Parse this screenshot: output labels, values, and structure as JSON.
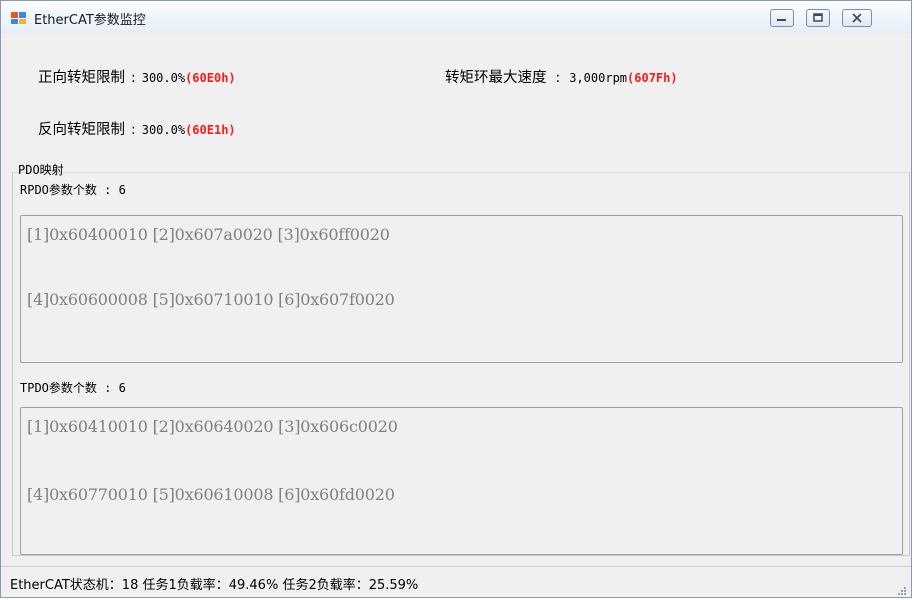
{
  "window": {
    "title": "EtherCAT参数监控"
  },
  "params": {
    "fwd_torque": {
      "label": "正向转矩限制",
      "sep": ":",
      "value": "300.0%",
      "code": "(60E0h)"
    },
    "rev_torque": {
      "label": "反向转矩限制",
      "sep": ":",
      "value": "300.0%",
      "code": "(60E1h)"
    },
    "max_speed": {
      "label": "转矩环最大速度",
      "sep": ":",
      "value": "3,000rpm",
      "code": "(607Fh)"
    }
  },
  "pdo": {
    "title": "PDO映射",
    "rpdo": {
      "count_label": "RPDO参数个数 : 6",
      "lines": [
        "[1]0x60400010 [2]0x607a0020 [3]0x60ff0020",
        "[4]0x60600008 [5]0x60710010 [6]0x607f0020"
      ]
    },
    "tpdo": {
      "count_label": "TPDO参数个数 : 6",
      "lines": [
        "[1]0x60410010 [2]0x60640020 [3]0x606c0020",
        "[4]0x60770010 [5]0x60610008 [6]0x60fd0020"
      ]
    }
  },
  "status": {
    "text": "EtherCAT状态机：18  任务1负载率：49.46%  任务2负载率：25.59%"
  },
  "colors": {
    "code_red": "#ff1a1a",
    "list_text_gray": "#808080",
    "window_bg": "#f0f0f0"
  },
  "icons": {
    "app": "ethercat-app-icon",
    "minimize": "minimize-icon",
    "maximize": "maximize-icon",
    "close": "close-icon",
    "resize": "resize-grip-icon"
  }
}
